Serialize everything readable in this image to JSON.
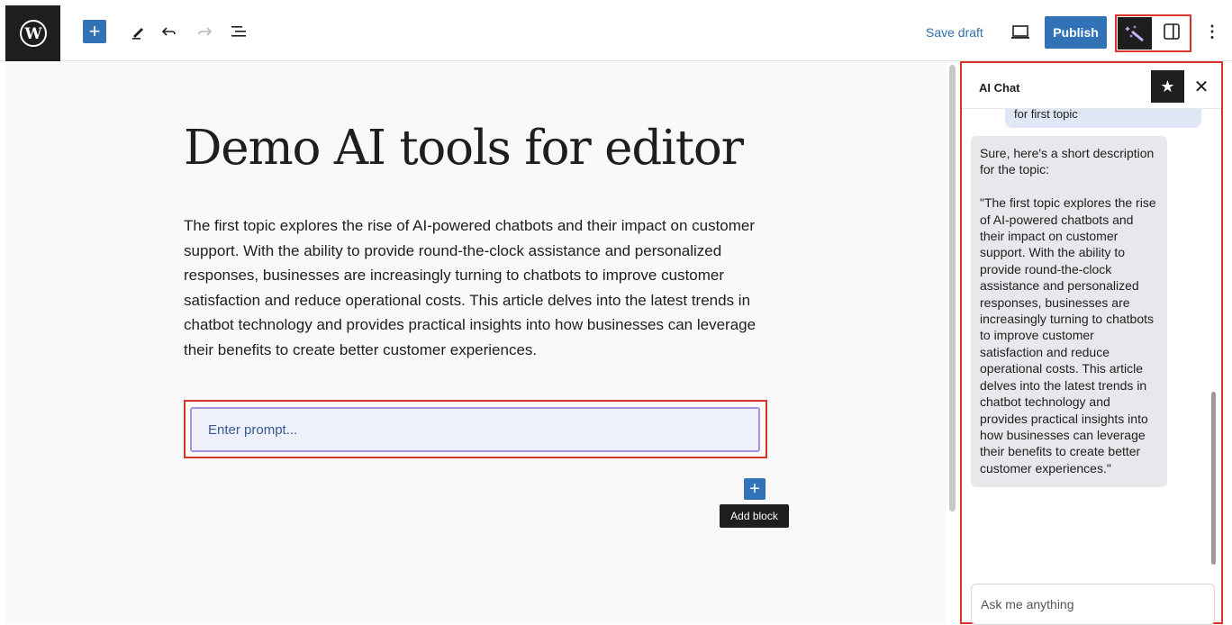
{
  "toolbar": {
    "add_block_symbol": "+",
    "save_draft_label": "Save draft",
    "publish_label": "Publish",
    "more_symbol": "⋮",
    "icons": {
      "logo": "wordpress-logo-icon",
      "tools": "pencil-icon",
      "undo": "undo-icon",
      "redo": "redo-icon",
      "outline": "list-view-icon",
      "preview": "laptop-icon",
      "ai": "magic-wand-icon",
      "settings": "sidebar-toggle-icon"
    },
    "accent_color": "#3273b8"
  },
  "editor": {
    "title": "Demo AI tools for editor",
    "body": "The first topic explores the rise of AI-powered chatbots and their impact on customer support. With the ability to provide round-the-clock assistance and personalized responses, businesses are increasingly turning to chatbots to improve customer satisfaction and reduce operational costs. This article delves into the latest trends in chatbot technology and provides practical insights into how businesses can leverage their benefits to create better customer experiences.",
    "prompt_placeholder": "Enter prompt...",
    "add_block_symbol": "+",
    "add_block_tooltip": "Add block"
  },
  "sidebar": {
    "title": "AI Chat",
    "star_symbol": "★",
    "close_symbol": "✕",
    "user_message": "for first topic",
    "ai_message": "Sure, here's a short description for the topic:\n\n\"The first topic explores the rise of AI-powered chatbots and their impact on customer support. With the ability to provide round-the-clock assistance and personalized responses, businesses are increasingly turning to chatbots to improve customer satisfaction and reduce operational costs. This article delves into the latest trends in chatbot technology and provides practical insights into how businesses can leverage their benefits to create better customer experiences.\"",
    "input_placeholder": "Ask me anything"
  },
  "highlight_color": "#d9342b"
}
